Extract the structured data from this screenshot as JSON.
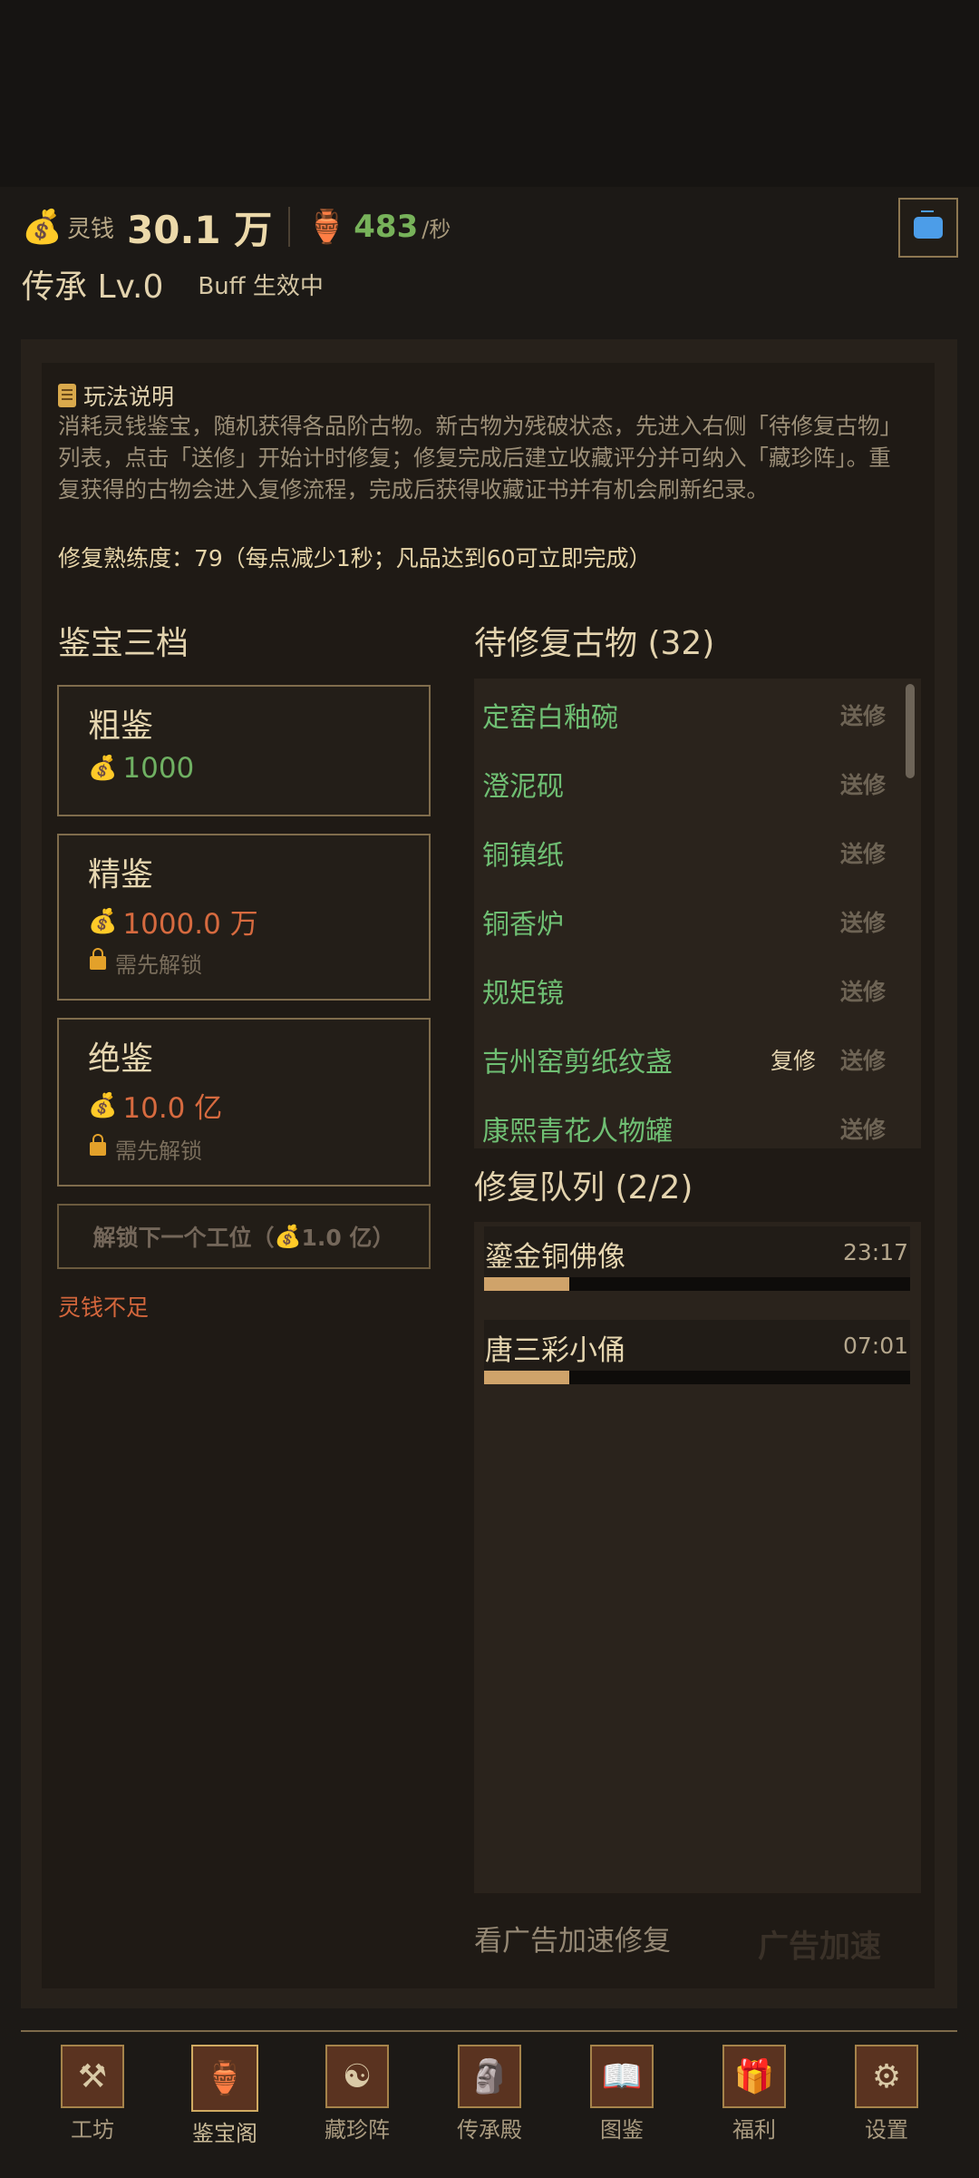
{
  "header": {
    "currency_icon": "money-bag-icon",
    "currency_label": "灵钱",
    "currency_value": "30.1 万",
    "rate_icon": "vase-icon",
    "rate_value": "483",
    "rate_unit": "/秒",
    "level": "传承 Lv.0",
    "buff_icon": "",
    "buff": "Buff 生效中"
  },
  "rules": {
    "title": "玩法说明",
    "text": "消耗灵钱鉴宝，随机获得各品阶古物。新古物为残破状态，先进入右侧「待修复古物」列表，点击「送修」开始计时修复；修复完成后建立收藏评分并可纳入「藏珍阵」。重复获得的古物会进入复修流程，完成后获得收藏证书并有机会刷新纪录。",
    "mastery": "修复熟练度：79（每点减少1秒；凡品达到60可立即完成）"
  },
  "appraise": {
    "title": "鉴宝三档",
    "tiers": [
      {
        "name": "粗鉴",
        "price": "1000",
        "price_color": "#6fb062",
        "locked": false
      },
      {
        "name": "精鉴",
        "price": "1000.0 万",
        "price_color": "#d66a3f",
        "locked": true,
        "lock_text": "需先解锁"
      },
      {
        "name": "绝鉴",
        "price": "10.0 亿",
        "price_color": "#d66a3f",
        "locked": true,
        "lock_text": "需先解锁"
      }
    ],
    "unlock_prefix": "解锁下一个工位（",
    "unlock_price": "1.0 亿",
    "unlock_suffix": "）",
    "insufficient": "灵钱不足"
  },
  "pending": {
    "title": "待修复古物 (32)",
    "send_label": "送修",
    "restore_label": "复修",
    "items": [
      {
        "name": "定窑白釉碗",
        "restore": false
      },
      {
        "name": "澄泥砚",
        "restore": false
      },
      {
        "name": "铜镇纸",
        "restore": false
      },
      {
        "name": "铜香炉",
        "restore": false
      },
      {
        "name": "规矩镜",
        "restore": false
      },
      {
        "name": "吉州窑剪纸纹盏",
        "restore": true
      },
      {
        "name": "康熙青花人物罐",
        "restore": false
      }
    ]
  },
  "queue": {
    "title": "修复队列 (2/2)",
    "items": [
      {
        "name": "鎏金铜佛像",
        "time": "23:17",
        "progress": 0.2
      },
      {
        "name": "唐三彩小俑",
        "time": "07:01",
        "progress": 0.2
      }
    ]
  },
  "ad": {
    "text": "看广告加速修复",
    "button": "广告加速"
  },
  "nav": [
    {
      "label": "工坊",
      "icon": "anvil-icon",
      "glyph": "⚒",
      "active": false
    },
    {
      "label": "鉴宝阁",
      "icon": "magnifier-vase-icon",
      "glyph": "🏺",
      "active": true
    },
    {
      "label": "藏珍阵",
      "icon": "bagua-icon",
      "glyph": "☯",
      "active": false
    },
    {
      "label": "传承殿",
      "icon": "stele-icon",
      "glyph": "🗿",
      "active": false
    },
    {
      "label": "图鉴",
      "icon": "book-icon",
      "glyph": "📖",
      "active": false
    },
    {
      "label": "福利",
      "icon": "gift-box-icon",
      "glyph": "🎁",
      "active": false
    },
    {
      "label": "设置",
      "icon": "gear-icon",
      "glyph": "⚙",
      "active": false
    }
  ]
}
